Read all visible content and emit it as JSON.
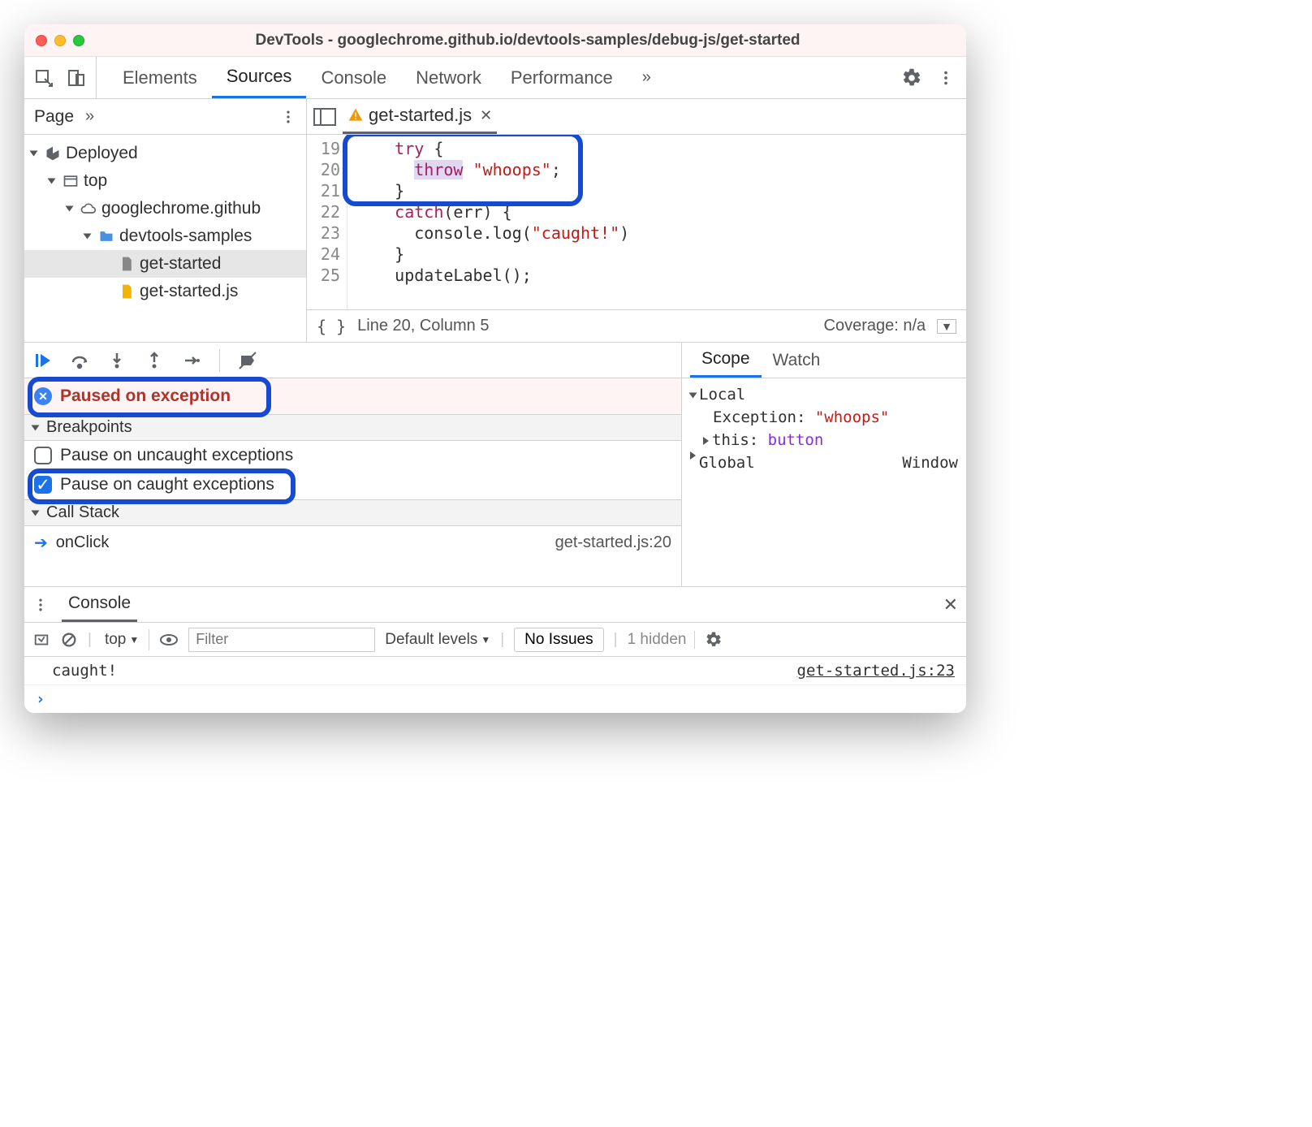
{
  "title": "DevTools - googlechrome.github.io/devtools-samples/debug-js/get-started",
  "tabs": [
    "Elements",
    "Sources",
    "Console",
    "Network",
    "Performance"
  ],
  "activeTab": "Sources",
  "sidepanel": {
    "label": "Page"
  },
  "tree": {
    "deployed": "Deployed",
    "top": "top",
    "domain": "googlechrome.github",
    "folder": "devtools-samples",
    "file1": "get-started",
    "file2": "get-started.js"
  },
  "editor": {
    "filename": "get-started.js",
    "lines": [
      "19",
      "20",
      "21",
      "22",
      "23",
      "24",
      "25"
    ],
    "code": {
      "l19": "    try {",
      "l20a": "      ",
      "l20_throw": "throw",
      "l20_sp": " ",
      "l20_str": "\"whoops\"",
      "l20b": ";",
      "l21": "    }",
      "l22a": "    ",
      "l22_catch": "catch",
      "l22b": "(err) {",
      "l23a": "      console.log(",
      "l23_str": "\"caught!\"",
      "l23b": ")",
      "l24": "    }",
      "l25": "    updateLabel();"
    }
  },
  "status": {
    "pos": "Line 20, Column 5",
    "coverage": "Coverage: n/a"
  },
  "debugger": {
    "paused": "Paused on exception",
    "bpSection": "Breakpoints",
    "bpUncaught": "Pause on uncaught exceptions",
    "bpCaught": "Pause on caught exceptions",
    "csSection": "Call Stack",
    "csFrame": "onClick",
    "csLoc": "get-started.js:20"
  },
  "scope": {
    "tabs": [
      "Scope",
      "Watch"
    ],
    "local": "Local",
    "exLabel": "Exception: ",
    "exVal": "\"whoops\"",
    "thisLabel": "this: ",
    "thisVal": "button",
    "global": "Global",
    "globalVal": "Window"
  },
  "drawer": {
    "tab": "Console"
  },
  "consoleBar": {
    "context": "top",
    "filterPlaceholder": "Filter",
    "levels": "Default levels",
    "issues": "No Issues",
    "hidden": "1 hidden"
  },
  "consoleLog": {
    "msg": "caught!",
    "src": "get-started.js:23"
  }
}
